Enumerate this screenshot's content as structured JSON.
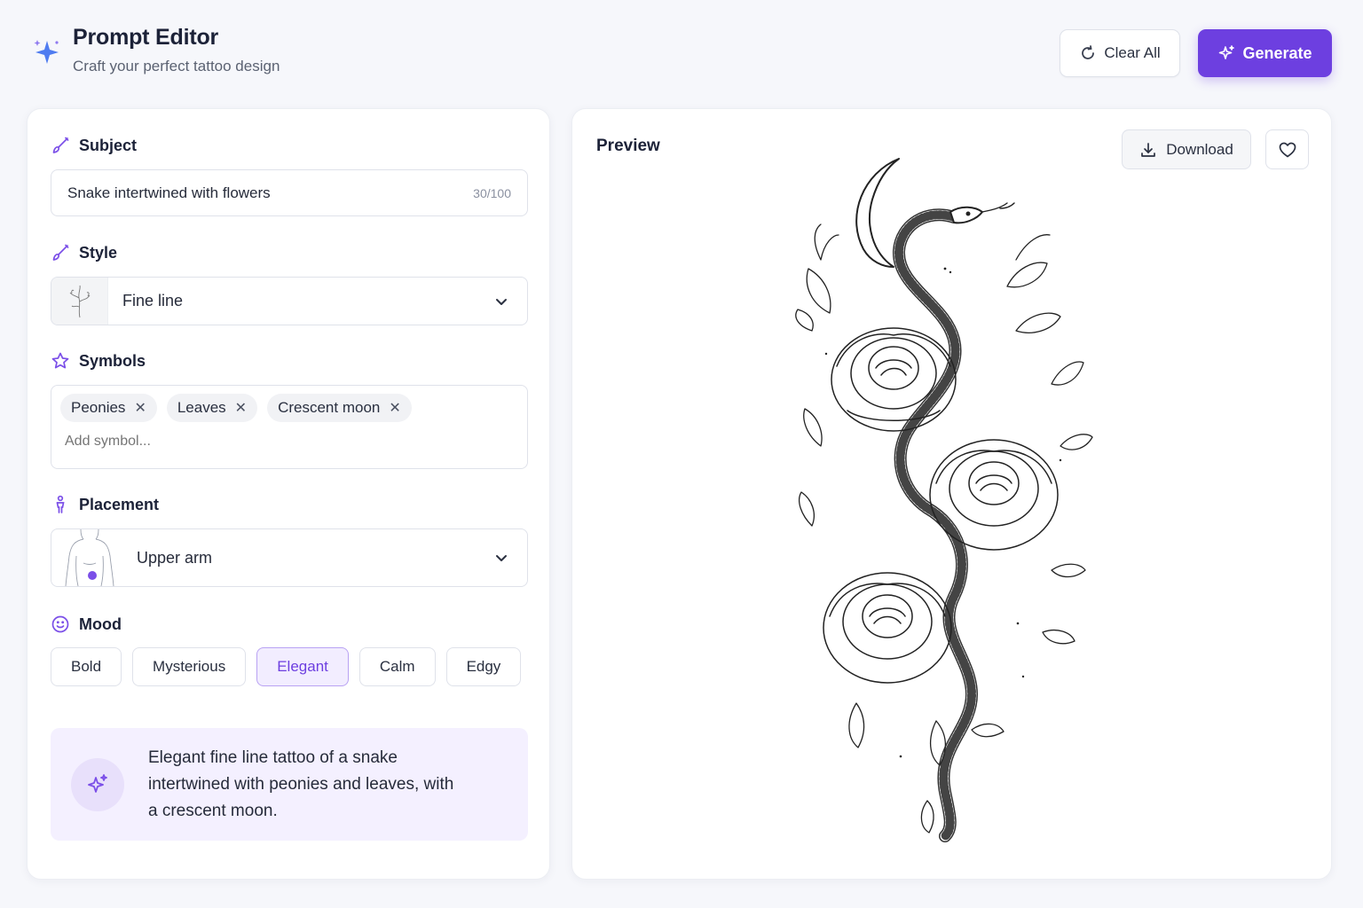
{
  "header": {
    "title": "Prompt Editor",
    "subtitle": "Craft your perfect tattoo design",
    "clear_label": "Clear All",
    "generate_label": "Generate",
    "logo_icon": "sparkles-icon"
  },
  "subject": {
    "label": "Subject",
    "value": "Snake intertwined with flowers",
    "counter": "30/100"
  },
  "style": {
    "label": "Style",
    "selected": "Fine line"
  },
  "symbols": {
    "label": "Symbols",
    "chips": [
      "Peonies",
      "Leaves",
      "Crescent moon"
    ],
    "placeholder": "Add symbol..."
  },
  "placement": {
    "label": "Placement",
    "selected": "Upper arm"
  },
  "mood": {
    "label": "Mood",
    "options": [
      "Bold",
      "Mysterious",
      "Elegant",
      "Calm",
      "Edgy"
    ],
    "selected": "Elegant"
  },
  "summary": {
    "text": "Elegant fine line tattoo of a snake intertwined with peonies and leaves, with a crescent moon."
  },
  "preview": {
    "title": "Preview",
    "download_label": "Download"
  },
  "colors": {
    "accent": "#6d3fe0",
    "accent_light": "#f4f0ff",
    "background": "#f6f7fb"
  }
}
